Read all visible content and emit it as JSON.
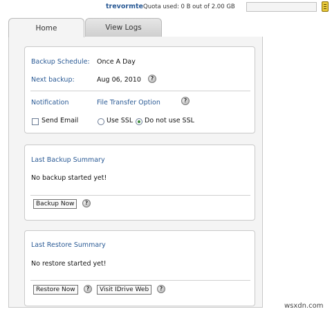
{
  "header": {
    "username": "trevormte",
    "quota_text": "Quota used: 0 B out of 2.00 GB",
    "quota_fraction": 0.0,
    "quota_icon": "database-icon"
  },
  "tabs": [
    {
      "label": "Home",
      "active": true
    },
    {
      "label": "View Logs",
      "active": false
    }
  ],
  "schedule": {
    "backup_schedule_label": "Backup Schedule:",
    "backup_schedule_value": "Once A Day",
    "next_backup_label": "Next backup:",
    "next_backup_value": "Aug 06, 2010",
    "notification_label": "Notification",
    "transfer_option_label": "File Transfer Option",
    "send_email_label": "Send Email",
    "send_email_checked": false,
    "use_ssl_label": "Use SSL",
    "no_ssl_label": "Do not use SSL",
    "selected_transfer": "Do not use SSL"
  },
  "last_backup": {
    "title": "Last Backup Summary",
    "status": "No backup started yet!",
    "button_label": "Backup Now"
  },
  "last_restore": {
    "title": "Last Restore Summary",
    "status": "No restore started yet!",
    "restore_button_label": "Restore Now",
    "visit_button_label": "Visit IDrive Web"
  },
  "help_glyph": "?",
  "watermark": "wsxdn.com",
  "colors": {
    "link_blue": "#2a5a95",
    "panel_bg": "#f4f4f4",
    "radio_selected": "#3a8a3a"
  }
}
